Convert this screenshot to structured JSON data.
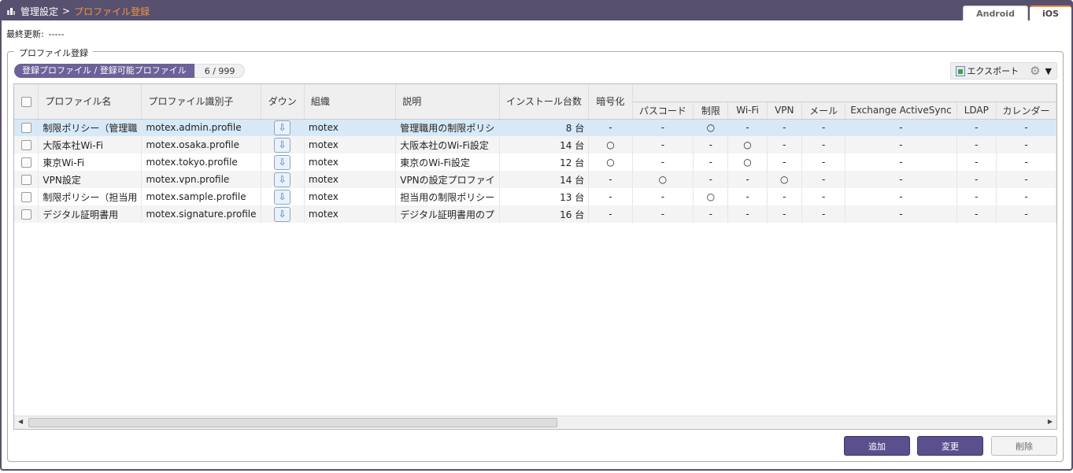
{
  "breadcrumb": {
    "parent": "管理設定",
    "separator": ">",
    "current": "プロファイル登録"
  },
  "os_tabs": [
    "Android",
    "iOS"
  ],
  "last_update": {
    "label": "最終更新:",
    "value": "-----"
  },
  "group_title": "プロファイル登録",
  "count": {
    "label": "登録プロファイル / 登録可能プロファイル",
    "value": "6 / 999"
  },
  "toolbar": {
    "export_label": "エクスポート",
    "menu_caret": "▼"
  },
  "columns": {
    "name": "プロファイル名",
    "identifier": "プロファイル識別子",
    "download": "ダウン",
    "org": "組織",
    "description": "説明",
    "installs": "インストール台数",
    "encryption": "暗号化",
    "passcode": "パスコード",
    "restriction": "制限",
    "wifi": "Wi-Fi",
    "vpn": "VPN",
    "mail": "メール",
    "exchange": "Exchange ActiveSync",
    "ldap": "LDAP",
    "calendar": "カレンダー"
  },
  "rows": [
    {
      "name": "制限ポリシー（管理職",
      "identifier": "motex.admin.profile",
      "org": "motex",
      "description": "管理職用の制限ポリシ",
      "installs": "8 台",
      "encryption": "-",
      "passcode": "-",
      "restriction": "○",
      "wifi": "-",
      "vpn": "-",
      "mail": "-",
      "exchange": "-",
      "ldap": "-",
      "calendar": "-"
    },
    {
      "name": "大阪本社Wi-Fi",
      "identifier": "motex.osaka.profile",
      "org": "motex",
      "description": "大阪本社のWi-Fi設定",
      "installs": "14 台",
      "encryption": "○",
      "passcode": "-",
      "restriction": "-",
      "wifi": "○",
      "vpn": "-",
      "mail": "-",
      "exchange": "-",
      "ldap": "-",
      "calendar": "-"
    },
    {
      "name": "東京Wi-Fi",
      "identifier": "motex.tokyo.profile",
      "org": "motex",
      "description": "東京のWi-Fi設定",
      "installs": "12 台",
      "encryption": "○",
      "passcode": "-",
      "restriction": "-",
      "wifi": "○",
      "vpn": "-",
      "mail": "-",
      "exchange": "-",
      "ldap": "-",
      "calendar": "-"
    },
    {
      "name": "VPN設定",
      "identifier": "motex.vpn.profile",
      "org": "motex",
      "description": "VPNの設定プロファイ",
      "installs": "14 台",
      "encryption": "-",
      "passcode": "○",
      "restriction": "-",
      "wifi": "-",
      "vpn": "○",
      "mail": "-",
      "exchange": "-",
      "ldap": "-",
      "calendar": "-"
    },
    {
      "name": "制限ポリシー（担当用",
      "identifier": "motex.sample.profile",
      "org": "motex",
      "description": "担当用の制限ポリシー",
      "installs": "13 台",
      "encryption": "-",
      "passcode": "-",
      "restriction": "○",
      "wifi": "-",
      "vpn": "-",
      "mail": "-",
      "exchange": "-",
      "ldap": "-",
      "calendar": "-"
    },
    {
      "name": "デジタル証明書用",
      "identifier": "motex.signature.profile",
      "org": "motex",
      "description": "デジタル証明書用のプ",
      "installs": "16 台",
      "encryption": "-",
      "passcode": "-",
      "restriction": "-",
      "wifi": "-",
      "vpn": "-",
      "mail": "-",
      "exchange": "-",
      "ldap": "-",
      "calendar": "-"
    }
  ],
  "buttons": {
    "add": "追加",
    "edit": "変更",
    "delete": "削除"
  }
}
